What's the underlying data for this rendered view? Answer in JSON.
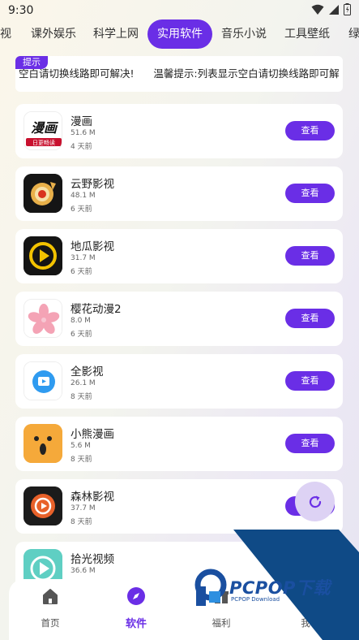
{
  "status": {
    "time": "9:30"
  },
  "tabs": [
    "视",
    "课外娱乐",
    "科学上网",
    "实用软件",
    "音乐小说",
    "工具壁纸",
    "绿"
  ],
  "notice": {
    "tag": "提示",
    "text": "空白请切换线路即可解决!      温馨提示:列表显示空白请切换线路即可解"
  },
  "apps": [
    {
      "name": "漫画",
      "size": "51.6 M",
      "time": "4 天前",
      "button": "查看",
      "icon": "manhua-app-icon"
    },
    {
      "name": "云野影视",
      "size": "48.1 M",
      "time": "6 天前",
      "button": "查看",
      "icon": "yunye-app-icon"
    },
    {
      "name": "地瓜影视",
      "size": "31.7 M",
      "time": "6 天前",
      "button": "查看",
      "icon": "digua-app-icon"
    },
    {
      "name": "樱花动漫2",
      "size": "8.0 M",
      "time": "6 天前",
      "button": "查看",
      "icon": "sakura-app-icon"
    },
    {
      "name": "全影视",
      "size": "26.1 M",
      "time": "8 天前",
      "button": "查看",
      "icon": "quan-app-icon"
    },
    {
      "name": "小熊漫画",
      "size": "5.6 M",
      "time": "8 天前",
      "button": "查看",
      "icon": "bear-app-icon"
    },
    {
      "name": "森林影视",
      "size": "37.7 M",
      "time": "8 天前",
      "button": "查看",
      "icon": "forest-app-icon"
    },
    {
      "name": "拾光视频",
      "size": "36.6 M",
      "time": "",
      "button": "",
      "icon": "shiguang-app-icon"
    }
  ],
  "icon_text": {
    "manhua_logo": "漫画",
    "manhua_sub": "日更畅读"
  },
  "nav": [
    {
      "label": "首页",
      "icon": "home-icon"
    },
    {
      "label": "软件",
      "icon": "compass-icon"
    },
    {
      "label": "福利",
      "icon": "gift-icon"
    },
    {
      "label": "我",
      "icon": "profile-icon"
    }
  ],
  "watermark": {
    "text": "PCPOP下载",
    "sub": "PCPOP Download"
  },
  "colors": {
    "accent": "#6a2ee6",
    "fab": "#ddd2f4",
    "watermark": "#1a4fa0"
  }
}
